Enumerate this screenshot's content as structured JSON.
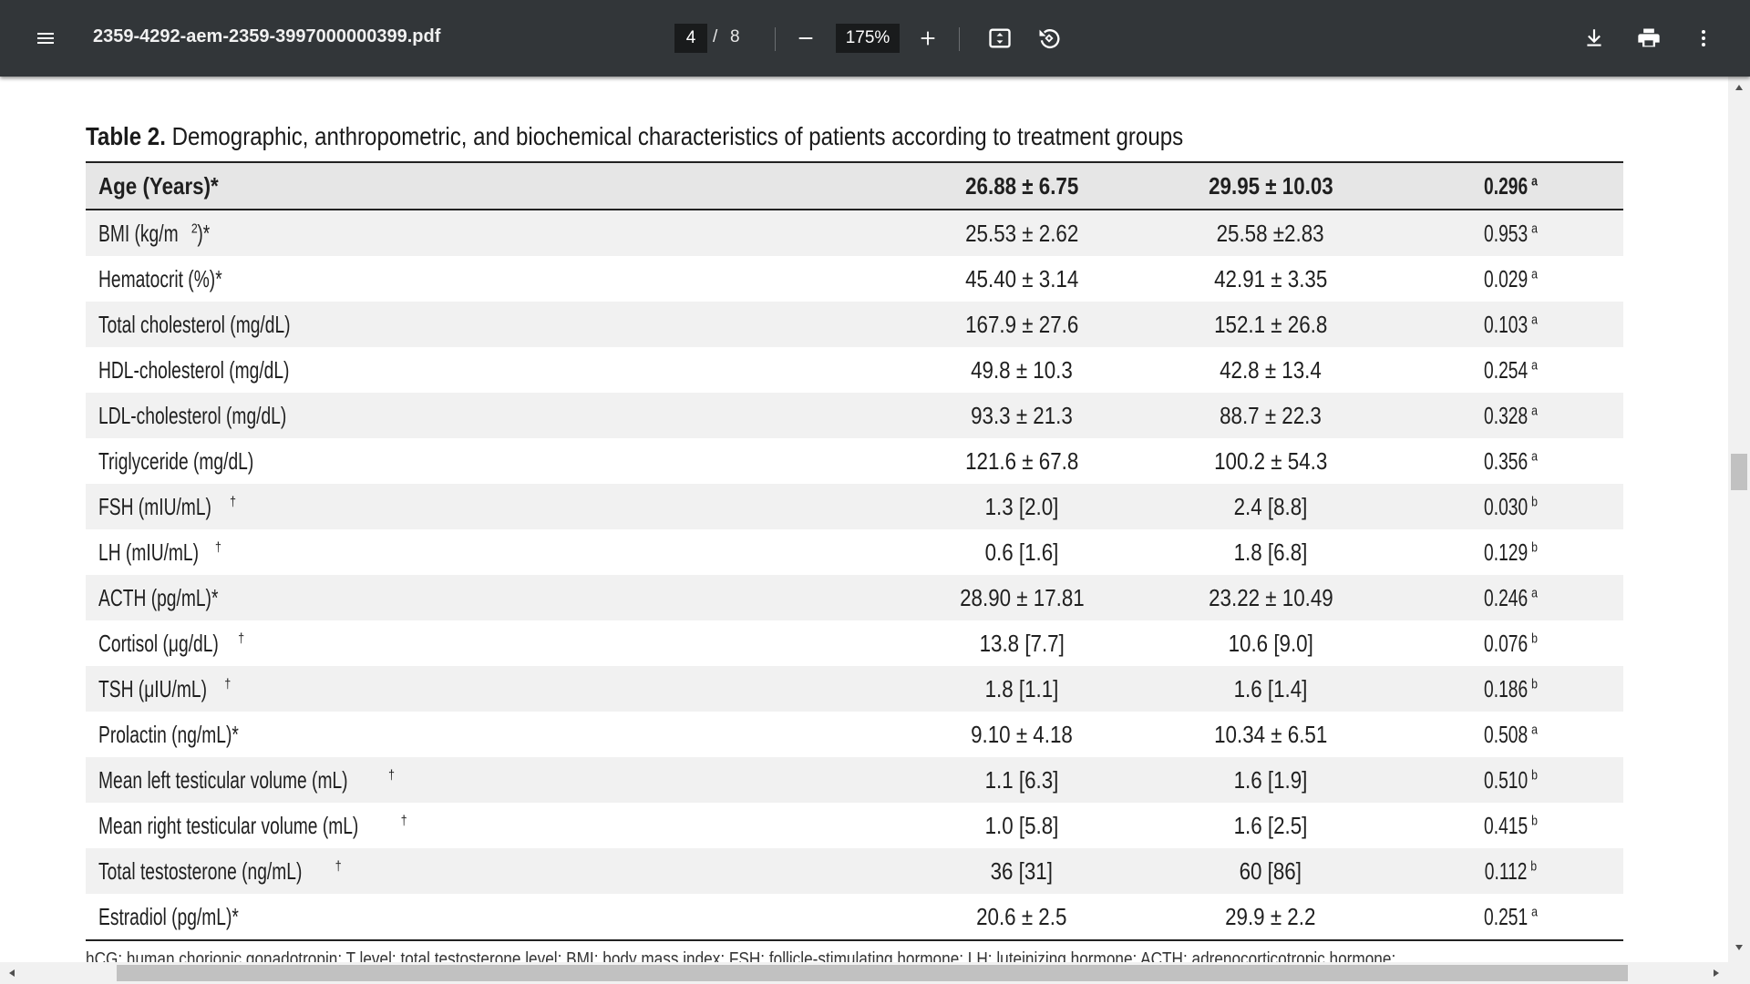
{
  "toolbar": {
    "title": "2359-4292-aem-2359-3997000000399.pdf",
    "page_current": "4",
    "page_separator": "/",
    "page_total": "8",
    "zoom": "175%",
    "icons": [
      "menu-icon",
      "zoom-out-icon",
      "zoom-in-icon",
      "fit-to-page-icon",
      "rotate-icon",
      "download-icon",
      "print-icon",
      "more-vert-icon"
    ]
  },
  "document": {
    "caption_number": "Table 2.",
    "caption_text": " Demographic, anthropometric, and biochemical characteristics of patients according to treatment groups",
    "header_row": {
      "label": "Age (Years)*",
      "col1": "26.88 ± 6.75",
      "col2": "29.95 ± 10.03",
      "p": "0.296",
      "p_sup": "a"
    },
    "rows": [
      {
        "label": "BMI (kg/m",
        "label_sup": "2",
        "label_after": ")*",
        "col1": "25.53 ± 2.62",
        "col2": "25.58 ±2.83",
        "p": "0.953",
        "p_sup": "a"
      },
      {
        "label": "Hematocrit (%)*",
        "label_sup": "",
        "label_after": "",
        "col1": "45.40 ± 3.14",
        "col2": "42.91 ± 3.35",
        "p": "0.029",
        "p_sup": "a"
      },
      {
        "label": "Total cholesterol (mg/dL)",
        "label_sup": "",
        "label_after": "",
        "col1": "167.9 ± 27.6",
        "col2": "152.1 ± 26.8",
        "p": "0.103",
        "p_sup": "a"
      },
      {
        "label": "HDL-cholesterol (mg/dL)",
        "label_sup": "",
        "label_after": "",
        "col1": "49.8 ± 10.3",
        "col2": "42.8 ± 13.4",
        "p": "0.254",
        "p_sup": "a"
      },
      {
        "label": "LDL-cholesterol (mg/dL)",
        "label_sup": "",
        "label_after": "",
        "col1": "93.3 ± 21.3",
        "col2": "88.7 ± 22.3",
        "p": "0.328",
        "p_sup": "a"
      },
      {
        "label": "Triglyceride (mg/dL)",
        "label_sup": "",
        "label_after": "",
        "col1": "121.6 ± 67.8",
        "col2": "100.2 ± 54.3",
        "p": "0.356",
        "p_sup": "a"
      },
      {
        "label": "FSH (mIU/mL)",
        "label_sup": "†",
        "label_after": "",
        "col1": "1.3 [2.0]",
        "col2": "2.4 [8.8]",
        "p": "0.030",
        "p_sup": "b"
      },
      {
        "label": "LH (mIU/mL)",
        "label_sup": "†",
        "label_after": "",
        "col1": "0.6 [1.6]",
        "col2": "1.8 [6.8]",
        "p": "0.129",
        "p_sup": "b"
      },
      {
        "label": "ACTH (pg/mL)*",
        "label_sup": "",
        "label_after": "",
        "col1": "28.90 ± 17.81",
        "col2": "23.22 ± 10.49",
        "p": "0.246",
        "p_sup": "a"
      },
      {
        "label": "Cortisol (μg/dL)",
        "label_sup": "†",
        "label_after": "",
        "col1": "13.8 [7.7]",
        "col2": "10.6 [9.0]",
        "p": "0.076",
        "p_sup": "b"
      },
      {
        "label": "TSH (μIU/mL)",
        "label_sup": "†",
        "label_after": "",
        "col1": "1.8 [1.1]",
        "col2": "1.6 [1.4]",
        "p": "0.186",
        "p_sup": "b"
      },
      {
        "label": "Prolactin (ng/mL)*",
        "label_sup": "",
        "label_after": "",
        "col1": "9.10 ± 4.18",
        "col2": "10.34 ± 6.51",
        "p": "0.508",
        "p_sup": "a"
      },
      {
        "label": "Mean left testicular volume (mL)",
        "label_sup": "†",
        "label_after": "",
        "col1": "1.1 [6.3]",
        "col2": "1.6 [1.9]",
        "p": "0.510",
        "p_sup": "b"
      },
      {
        "label": "Mean right testicular volume (mL)",
        "label_sup": "†",
        "label_after": "",
        "col1": "1.0 [5.8]",
        "col2": "1.6 [2.5]",
        "p": "0.415",
        "p_sup": "b"
      },
      {
        "label": "Total testosterone (ng/mL)",
        "label_sup": "†",
        "label_after": "",
        "col1": "36 [31]",
        "col2": "60 [86]",
        "p": "0.112",
        "p_sup": "b"
      },
      {
        "label": "Estradiol (pg/mL)*",
        "label_sup": "",
        "label_after": "",
        "col1": "20.6 ± 2.5",
        "col2": "29.9 ± 2.2",
        "p": "0.251",
        "p_sup": "a"
      }
    ],
    "footnote": "hCG: human chorionic gonadotropin; T level: total testosterone level; BMI: body mass index; FSH: follicle-stimulating hormone; LH: luteinizing hormone; ACTH: adrenocorticotropic hormone;"
  }
}
